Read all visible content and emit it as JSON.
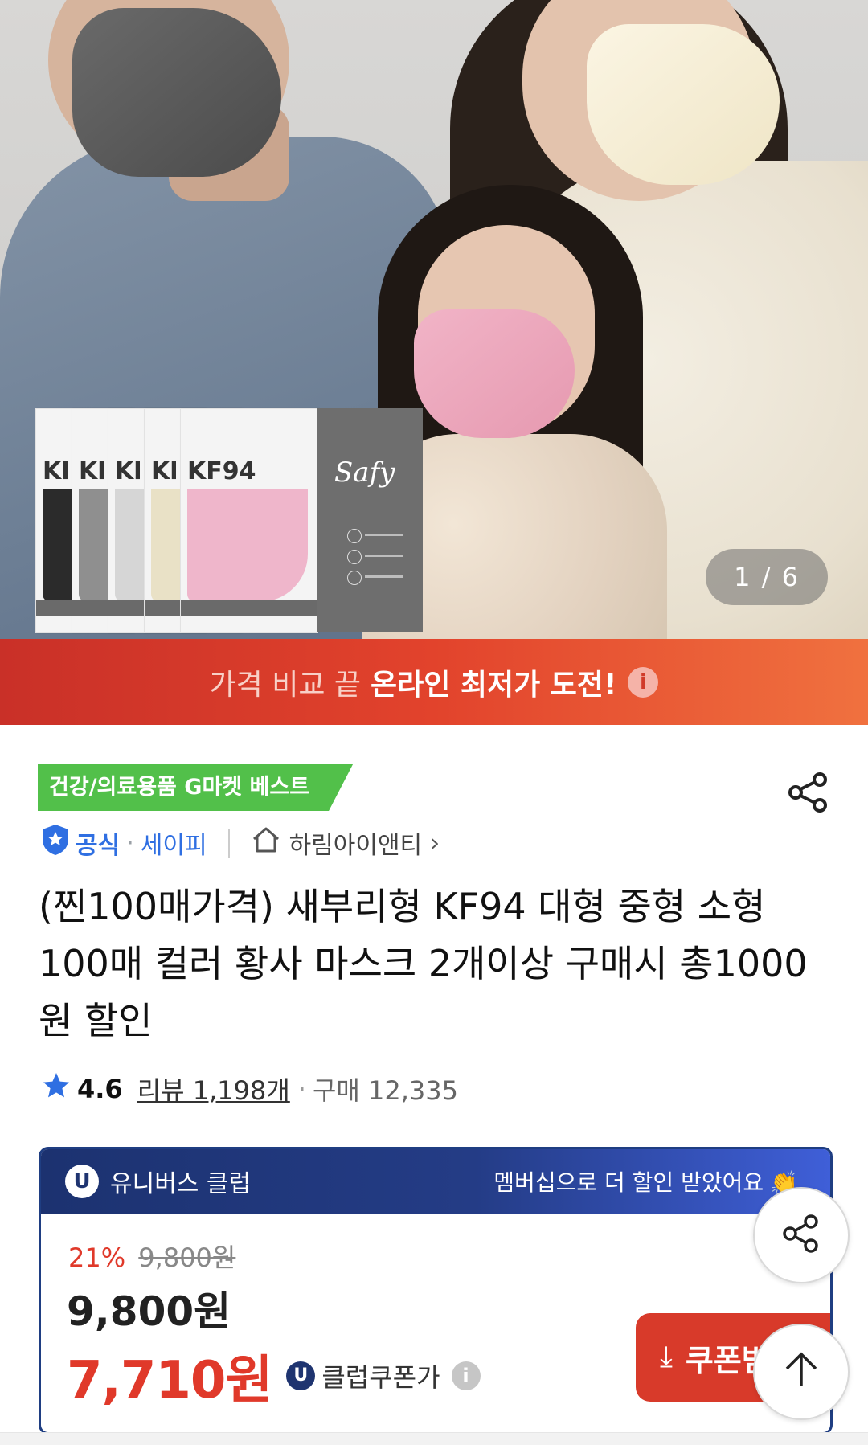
{
  "hero": {
    "pager": "1 / 6",
    "pack_label": "KF94",
    "pack_partial_label": "Kl",
    "pack_brand": "Safy"
  },
  "promo": {
    "light_text": "가격 비교 끝",
    "bold_text": "온라인 최저가 도전!",
    "info_glyph": "i"
  },
  "badges": {
    "best": "건강/의료용품 G마켓 베스트"
  },
  "seller": {
    "official": "공식",
    "separator": "·",
    "safe": "세이피",
    "shop_name": "하림아이앤티",
    "chevron": "›"
  },
  "product": {
    "title": "(찐100매가격) 새부리형 KF94 대형 중형 소형 100매 컬러 황사 마스크 2개이상 구매시 총1000원 할인"
  },
  "rating": {
    "score": "4.6",
    "reviews": "리뷰 1,198개",
    "separator": "·",
    "purchases": "구매 12,335"
  },
  "club": {
    "badge_letter": "U",
    "name": "유니버스 클럽",
    "message": "멤버십으로 더 할인 받았어요",
    "clap": "👏",
    "discount_pct": "21%",
    "original_price": "9,800원",
    "price": "9,800원",
    "coupon_price": "7,710원",
    "coupon_label": "클럽쿠폰가",
    "info_glyph": "i",
    "coupon_button": "쿠폰받기",
    "download_glyph": "⤓"
  },
  "colors": {
    "accent_red": "#e0392a",
    "club_navy": "#1f3470",
    "best_green": "#52c04a",
    "official_blue": "#2f6fe2"
  },
  "icons": {
    "share": "share-icon",
    "official": "shield-star-icon",
    "shop": "home-icon",
    "star": "star-icon",
    "scroll_top": "arrow-up-icon"
  }
}
